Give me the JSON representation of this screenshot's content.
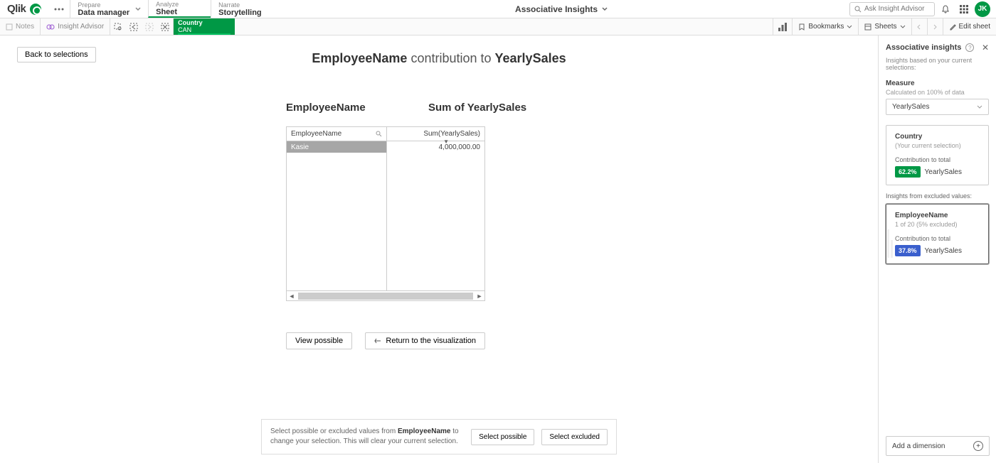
{
  "header": {
    "logo_text": "Qlik",
    "nav": {
      "prepare": {
        "top": "Prepare",
        "bottom": "Data manager"
      },
      "analyze": {
        "top": "Analyze",
        "bottom": "Sheet"
      },
      "narrate": {
        "top": "Narrate",
        "bottom": "Storytelling"
      }
    },
    "center_title": "Associative Insights",
    "search_placeholder": "Ask Insight Advisor",
    "avatar_initials": "JK"
  },
  "toolbar": {
    "notes": "Notes",
    "insight_advisor": "Insight Advisor",
    "selection_chip": {
      "label": "Country",
      "value": "CAN"
    },
    "bookmarks": "Bookmarks",
    "sheets": "Sheets",
    "edit_sheet": "Edit sheet"
  },
  "main": {
    "back_button": "Back to selections",
    "title_bold1": "EmployeeName",
    "title_mid": " contribution to ",
    "title_bold2": "YearlySales",
    "col1_header": "EmployeeName",
    "col2_header": "Sum of YearlySales",
    "table": {
      "th_left": "EmployeeName",
      "th_right": "Sum(YearlySales)",
      "row_name": "Kasie",
      "row_value": "4,000,000.00"
    },
    "view_possible": "View possible",
    "return_viz": "Return to the visualization",
    "bottom": {
      "text_pre": "Select possible or excluded values from ",
      "text_bold": "EmployeeName",
      "text_post": " to change your selection. This will clear your current selection.",
      "select_possible": "Select possible",
      "select_excluded": "Select excluded"
    }
  },
  "panel": {
    "title": "Associative insights",
    "subtitle": "Insights based on your current selections:",
    "measure_label": "Measure",
    "measure_hint": "Calculated on 100% of data",
    "measure_value": "YearlySales",
    "card1": {
      "title": "Country",
      "subtitle": "(Your current selection)",
      "contrib_label": "Contribution to total",
      "badge": "62.2%",
      "metric": "YearlySales"
    },
    "excluded_label": "Insights from excluded values:",
    "card2": {
      "title": "EmployeeName",
      "subtitle": "1 of 20 (5% excluded)",
      "contrib_label": "Contribution to total",
      "badge": "37.8%",
      "metric": "YearlySales"
    },
    "add_dimension": "Add a dimension"
  }
}
